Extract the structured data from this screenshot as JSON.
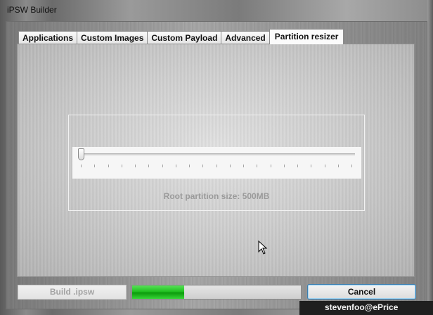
{
  "window": {
    "title": "iPSW Builder"
  },
  "tabs": [
    {
      "label": "Applications"
    },
    {
      "label": "Custom Images"
    },
    {
      "label": "Custom Payload"
    },
    {
      "label": "Advanced"
    },
    {
      "label": "Partition resizer"
    }
  ],
  "partition": {
    "size_label": "Root partition size: 500MB",
    "slider_value_fraction": 0.0,
    "tick_count": 21
  },
  "footer": {
    "build_label": "Build .ipsw",
    "progress_fraction": 0.31,
    "cancel_label": "Cancel"
  },
  "watermark": {
    "text": "stevenfoo@ePrice"
  },
  "icons": {
    "cursor": "mouse-pointer-icon"
  },
  "colors": {
    "progress": "#22c122",
    "cancel_border": "#3c7fb1"
  }
}
